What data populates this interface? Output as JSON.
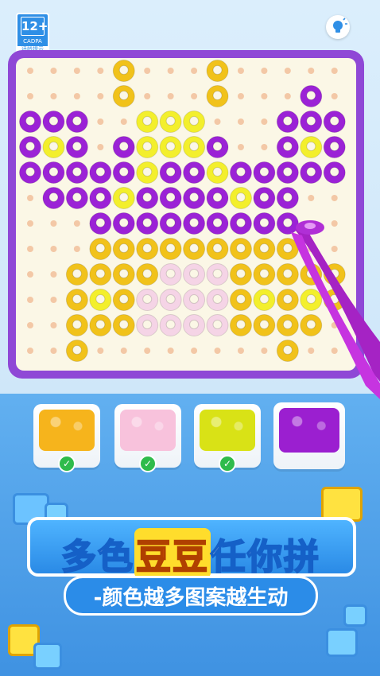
{
  "age_badge": {
    "rating": "12+",
    "org": "CADPA",
    "tip": "适龄提示"
  },
  "title": {
    "part1": "多色",
    "highlight": "豆豆",
    "part2": "任你拼"
  },
  "subtitle": "-颜色越多图案越生动",
  "trays": [
    {
      "color": "#f6b41c",
      "completed": true
    },
    {
      "color": "#f8c2dc",
      "completed": true
    },
    {
      "color": "#d9e216",
      "completed": true
    },
    {
      "color": "#9b1fd0",
      "completed": false
    }
  ],
  "colors": {
    "board_frame": "#8f48d6",
    "purple": "#9b22d6",
    "yellow": "#f1c21a",
    "lemon": "#f3ef2c",
    "pink": "#f5d4e6",
    "peg": "#f3c8a6"
  },
  "icons": {
    "bulb": "lightbulb-icon",
    "check": "check-icon",
    "tweezers": "tweezers-icon"
  }
}
